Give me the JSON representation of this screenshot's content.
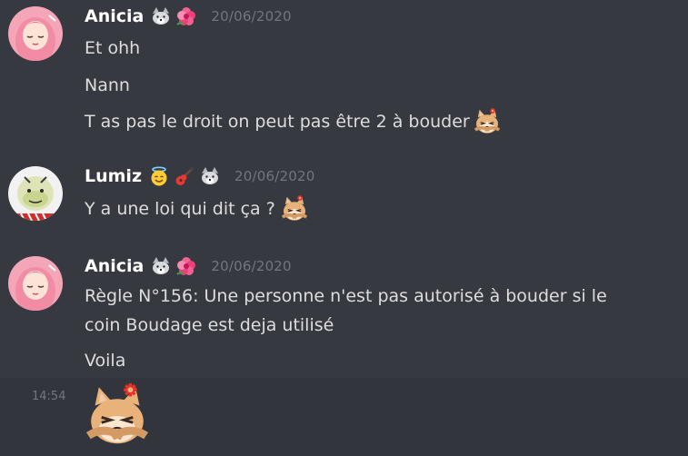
{
  "messages": [
    {
      "author": "Anicia",
      "timestamp": "20/06/2020",
      "badges": [
        "wolf-icon",
        "hibiscus-icon"
      ],
      "lines": [
        "Et ohh",
        "Nann",
        "T as pas le droit on peut pas être 2 à bouder"
      ],
      "line_emoji": [
        null,
        null,
        "pouting-cat-emoji"
      ]
    },
    {
      "author": "Lumiz",
      "timestamp": "20/06/2020",
      "badges": [
        "angel-smiley-icon",
        "guitar-icon",
        "wolf-icon"
      ],
      "lines": [
        "Y a une loi qui dit ça ?"
      ],
      "line_emoji": [
        "pouting-cat-emoji"
      ]
    },
    {
      "author": "Anicia",
      "timestamp": "20/06/2020",
      "badges": [
        "wolf-icon",
        "hibiscus-icon"
      ],
      "lines": [
        "Règle N°156: Une personne n'est pas autorisé à bouder si le",
        "coin Boudage est deja utilisé",
        "Voila"
      ],
      "line_emoji": [
        null,
        null,
        null
      ]
    }
  ],
  "hovered_message": {
    "time": "14:54",
    "content": "pouting-cat-emoji-large"
  },
  "colors": {
    "background": "#36393f",
    "hover_background": "#32353b",
    "username": "#ffffff",
    "text": "#dcddde",
    "timestamp": "#72767d"
  }
}
